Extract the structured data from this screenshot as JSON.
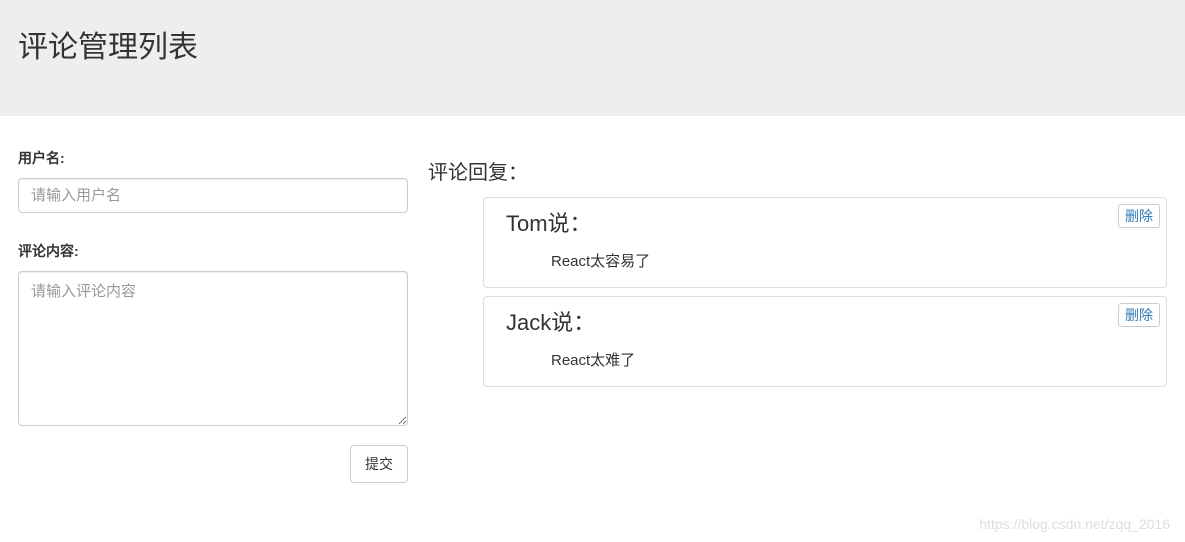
{
  "header": {
    "title": "评论管理列表"
  },
  "form": {
    "username_label": "用户名:",
    "username_placeholder": "请输入用户名",
    "content_label": "评论内容:",
    "content_placeholder": "请输入评论内容",
    "submit_label": "提交"
  },
  "reply": {
    "title": "评论回复：",
    "delete_label": "删除"
  },
  "comments": [
    {
      "user": "Tom说：",
      "content": "React太容易了"
    },
    {
      "user": "Jack说：",
      "content": "React太难了"
    }
  ],
  "watermark": "https://blog.csdn.net/zqq_2016"
}
